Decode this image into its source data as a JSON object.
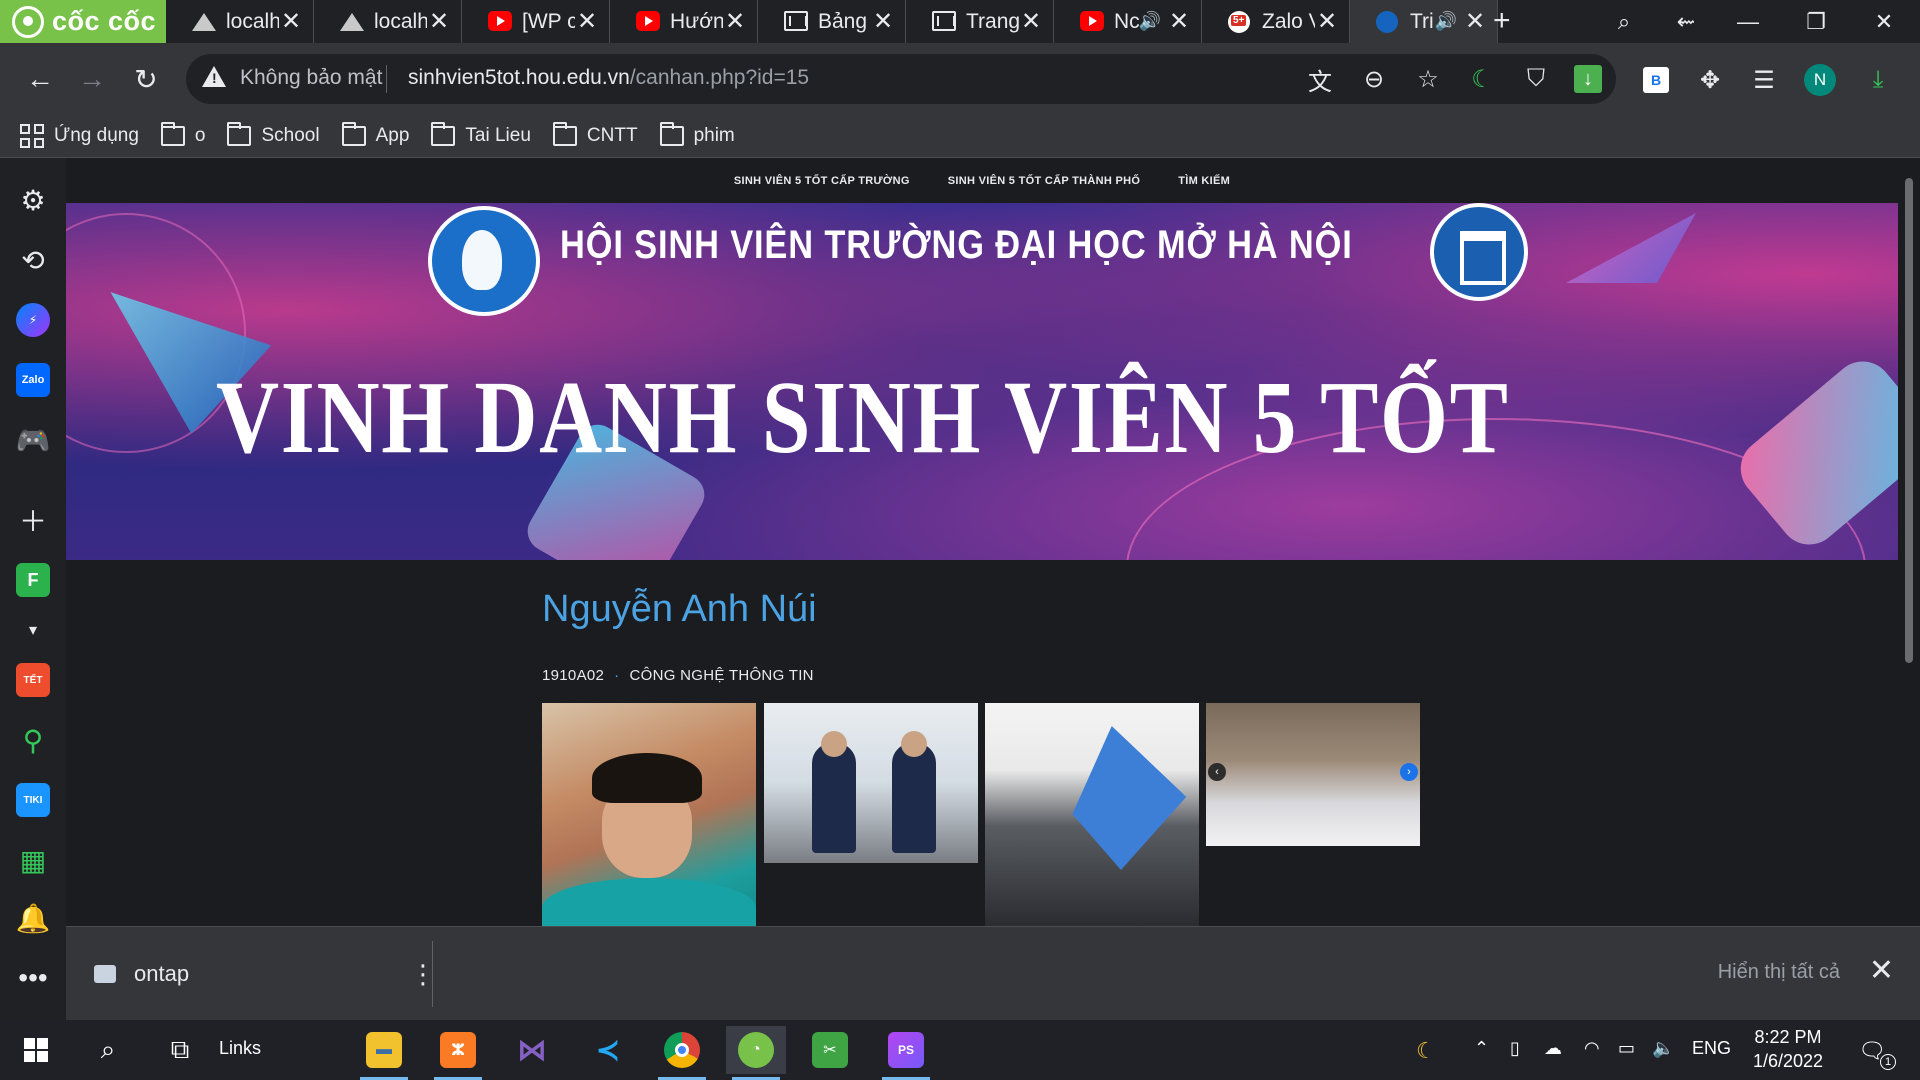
{
  "browser": {
    "brand": "cốc cốc",
    "tabs": [
      {
        "title": "localh",
        "icon": "mountain-icon"
      },
      {
        "title": "localh",
        "icon": "mountain-icon"
      },
      {
        "title": "[WP c",
        "icon": "youtube-icon"
      },
      {
        "title": "Hướn",
        "icon": "youtube-icon"
      },
      {
        "title": "Bảng",
        "icon": "wordpress-icon"
      },
      {
        "title": "Trang",
        "icon": "wordpress-icon"
      },
      {
        "title": "Nc",
        "icon": "youtube-icon",
        "audio": true
      },
      {
        "title": "Zalo V",
        "icon": "zalo-icon"
      },
      {
        "title": "Tri",
        "icon": "hsv-icon",
        "audio": true,
        "active": true
      }
    ]
  },
  "toolbar": {
    "security_label": "Không bảo mật",
    "url_host": "sinhvien5tot.hou.edu.vn",
    "url_path": "/canhan.php?id=15",
    "profile_initial": "N",
    "ext_b_label": "B"
  },
  "bookmarks": {
    "apps_label": "Ứng dụng",
    "items": [
      "o",
      "School",
      "App",
      "Tai Lieu",
      "CNTT",
      "phim"
    ]
  },
  "sidebar": {
    "zalo_label": "Zalo",
    "feedly_label": "F",
    "shopee_label": "TẾT",
    "tiki_label": "TIKI"
  },
  "page": {
    "nav": [
      "SINH VIÊN 5 TỐT CẤP TRƯỜNG",
      "SINH VIÊN 5 TỐT CẤP THÀNH PHỐ",
      "TÌM KIẾM"
    ],
    "banner_subtitle": "HỘI SINH VIÊN TRƯỜNG ĐẠI HỌC MỞ HÀ NỘI",
    "banner_title": "VINH DANH SINH VIÊN 5 TỐT",
    "person_name": "Nguyễn Anh Núi",
    "class_code": "1910A02",
    "separator": "·",
    "faculty": "CÔNG NGHỆ THÔNG TIN"
  },
  "downloads": {
    "file_name": "ontap",
    "show_all": "Hiển thị tất cả"
  },
  "taskbar": {
    "links_label": "Links",
    "language": "ENG",
    "time": "8:22 PM",
    "date": "1/6/2022",
    "notification_count": "1"
  },
  "colors": {
    "brand_green": "#79c24a",
    "link_blue": "#4ba3e3",
    "banner_bg": "#2f2d8f"
  }
}
